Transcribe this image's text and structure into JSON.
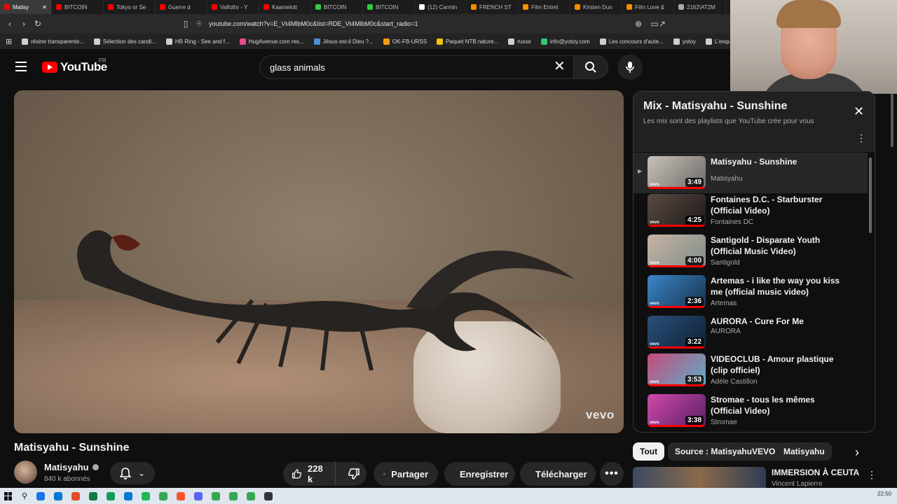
{
  "browser": {
    "tabs": [
      {
        "label": "Matisy",
        "color": "#ff0000",
        "active": true
      },
      {
        "label": "BITCOIN",
        "color": "#ff0000"
      },
      {
        "label": "Tokyo or Se",
        "color": "#ff0000"
      },
      {
        "label": "Guerre d",
        "color": "#ff0000"
      },
      {
        "label": "Valfothr - Y",
        "color": "#ff0000"
      },
      {
        "label": "Kaamelott",
        "color": "#ff0000"
      },
      {
        "label": "BITCOIN",
        "color": "#2ecc40"
      },
      {
        "label": "BITCOIN",
        "color": "#2ecc40"
      },
      {
        "label": "(12) Carmin",
        "color": "#ffffff"
      },
      {
        "label": "FRENCH ST",
        "color": "#ff8c00"
      },
      {
        "label": "Film Entret",
        "color": "#ff8c00"
      },
      {
        "label": "Kirsten Dun",
        "color": "#ff8c00"
      },
      {
        "label": "Film Love &",
        "color": "#ff8c00"
      },
      {
        "label": "2162\\AT2M",
        "color": "#aaaaaa"
      }
    ],
    "url": "youtube.com/watch?v=E_Vt4MlbM0c&list=RDE_Vt4MlbM0c&start_radio=1",
    "bookmarks": [
      "résine transparente...",
      "Sélection des candi...",
      "HB Ring - See and f...",
      "HugAvenue.com res...",
      "Jésus est-il Dieu ?...",
      "OK-FB-URSS",
      "Paquet NTB nature...",
      "russe",
      "info@yotoy.com",
      "Les concours d'aute...",
      "yotoy",
      "L'esqu"
    ]
  },
  "header": {
    "logo_text": "YouTube",
    "region": "FR",
    "search_value": "glass animals"
  },
  "video": {
    "watermark": "vevo",
    "title": "Matisyahu - Sunshine",
    "channel": "Matisyahu",
    "subscribers": "840 k abonnés",
    "likes": "228 k",
    "share_label": "Partager",
    "save_label": "Enregistrer",
    "download_label": "Télécharger"
  },
  "playlist": {
    "title": "Mix - Matisyahu - Sunshine",
    "subtitle": "Les mix sont des playlists que YouTube crée pour vous",
    "items": [
      {
        "title": "Matisyahu - Sunshine",
        "channel": "Matisyahu",
        "duration": "3:49",
        "current": true,
        "thumb": [
          "#c9c2bb",
          "#6e6a66"
        ]
      },
      {
        "title": "Fontaines D.C. - Starburster (Official Video)",
        "channel": "Fontaines DC",
        "duration": "4:25",
        "thumb": [
          "#5a4a44",
          "#1f1b19"
        ]
      },
      {
        "title": "Santigold - Disparate Youth (Official Music Video)",
        "channel": "Santigold",
        "duration": "4:00",
        "thumb": [
          "#c7b3a3",
          "#7f8e8a"
        ]
      },
      {
        "title": "Artemas - i like the way you kiss me (official music video)",
        "channel": "Artemas",
        "duration": "2:36",
        "thumb": [
          "#3b86c9",
          "#16324f"
        ]
      },
      {
        "title": "AURORA - Cure For Me",
        "channel": "AURORA",
        "duration": "3:22",
        "thumb": [
          "#2a4f7a",
          "#0f2236"
        ]
      },
      {
        "title": "VIDEOCLUB - Amour plastique (clip officiel)",
        "channel": "Adèle Castillon",
        "duration": "3:53",
        "thumb": [
          "#c74a7a",
          "#5bb0c8"
        ]
      },
      {
        "title": "Stromae - tous les mêmes (Official Video)",
        "channel": "Stromae",
        "duration": "3:38",
        "thumb": [
          "#d04aa8",
          "#5a1f66"
        ]
      }
    ]
  },
  "chips": [
    "Tout",
    "Source : MatisyahuVEVO",
    "Matisyahu"
  ],
  "recommendation": {
    "title": "IMMERSION À CEUTA",
    "channel": "Vincent Lapierre"
  },
  "taskbar": {
    "icons": [
      "#1a73e8",
      "#0078d4",
      "#e34c26",
      "#107c41",
      "#0f9d58",
      "#0078d4",
      "#1db954",
      "#34a853",
      "#fb542b",
      "#5865f2",
      "#34a853",
      "#34a853",
      "#34a853",
      "#333333"
    ],
    "clock": "22:50"
  }
}
